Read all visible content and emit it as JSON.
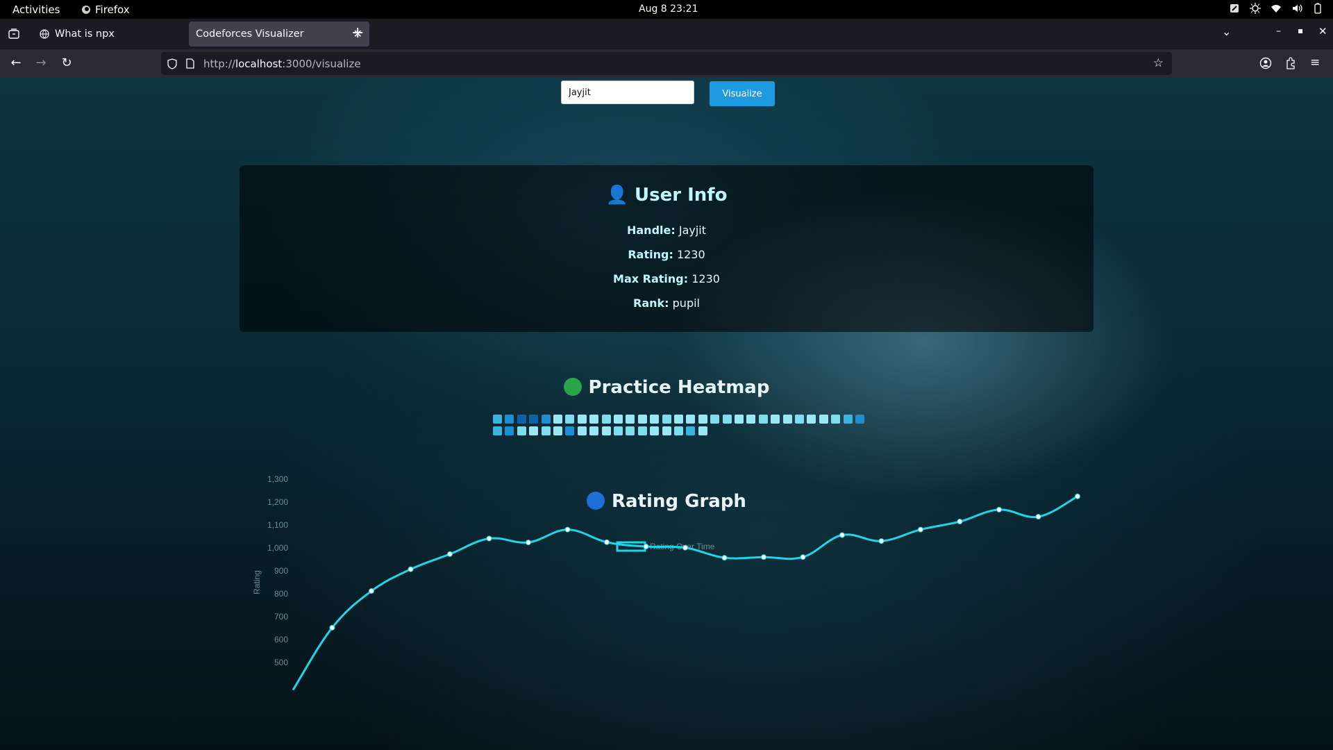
{
  "topbar": {
    "activities": "Activities",
    "app_name": "Firefox",
    "clock": "Aug 8  23:21"
  },
  "browser": {
    "tabs": [
      {
        "label": "What is npx",
        "active": false
      },
      {
        "label": "Codeforces Visualizer",
        "active": true
      }
    ],
    "url_host": "localhost",
    "url_prefix": "http://",
    "url_rest": ":3000/visualize"
  },
  "search": {
    "value": "Jayjit",
    "button_label": "Visualize"
  },
  "user_info": {
    "title": "User Info",
    "icon": "👤",
    "handle_label": "Handle:",
    "handle": "Jayjit",
    "rating_label": "Rating:",
    "rating": "1230",
    "max_rating_label": "Max Rating:",
    "max_rating": "1230",
    "rank_label": "Rank:",
    "rank": "pupil"
  },
  "heatmap": {
    "title": "Practice Heatmap",
    "dot_color": "#2aa44a",
    "row1": [
      3,
      2,
      1,
      1,
      2,
      5,
      4,
      5,
      5,
      4,
      5,
      5,
      5,
      5,
      4,
      5,
      5,
      5,
      4,
      4,
      5,
      5,
      4,
      5,
      5,
      4,
      5,
      5,
      4,
      3,
      2
    ],
    "row2": [
      3,
      2,
      4,
      5,
      4,
      5,
      2,
      5,
      5,
      5,
      4,
      4,
      4,
      5,
      5,
      4,
      3,
      5
    ],
    "colors": [
      "#0a4f86",
      "#0b63a8",
      "#1b8fd0",
      "#3ab6de",
      "#7fdcec",
      "#9be8f2"
    ]
  },
  "rating_graph": {
    "title": "Rating Graph",
    "dot_color": "#1e6fd8"
  },
  "chart_data": {
    "type": "line",
    "legend": [
      "Rating Over Time"
    ],
    "ylabel": "Rating",
    "yticks": [
      "1,300",
      "1,200",
      "1,100",
      "1,000",
      "900",
      "800",
      "700",
      "600",
      "500"
    ],
    "ylim": [
      500,
      1300
    ],
    "line_color": "#1fd6e6",
    "series": [
      {
        "name": "Rating Over Time",
        "values": [
          380,
          652,
          812,
          907,
          973,
          1041,
          1024,
          1080,
          1025,
          1006,
          1001,
          957,
          960,
          960,
          1056,
          1030,
          1080,
          1115,
          1167,
          1136,
          1225
        ]
      }
    ]
  }
}
